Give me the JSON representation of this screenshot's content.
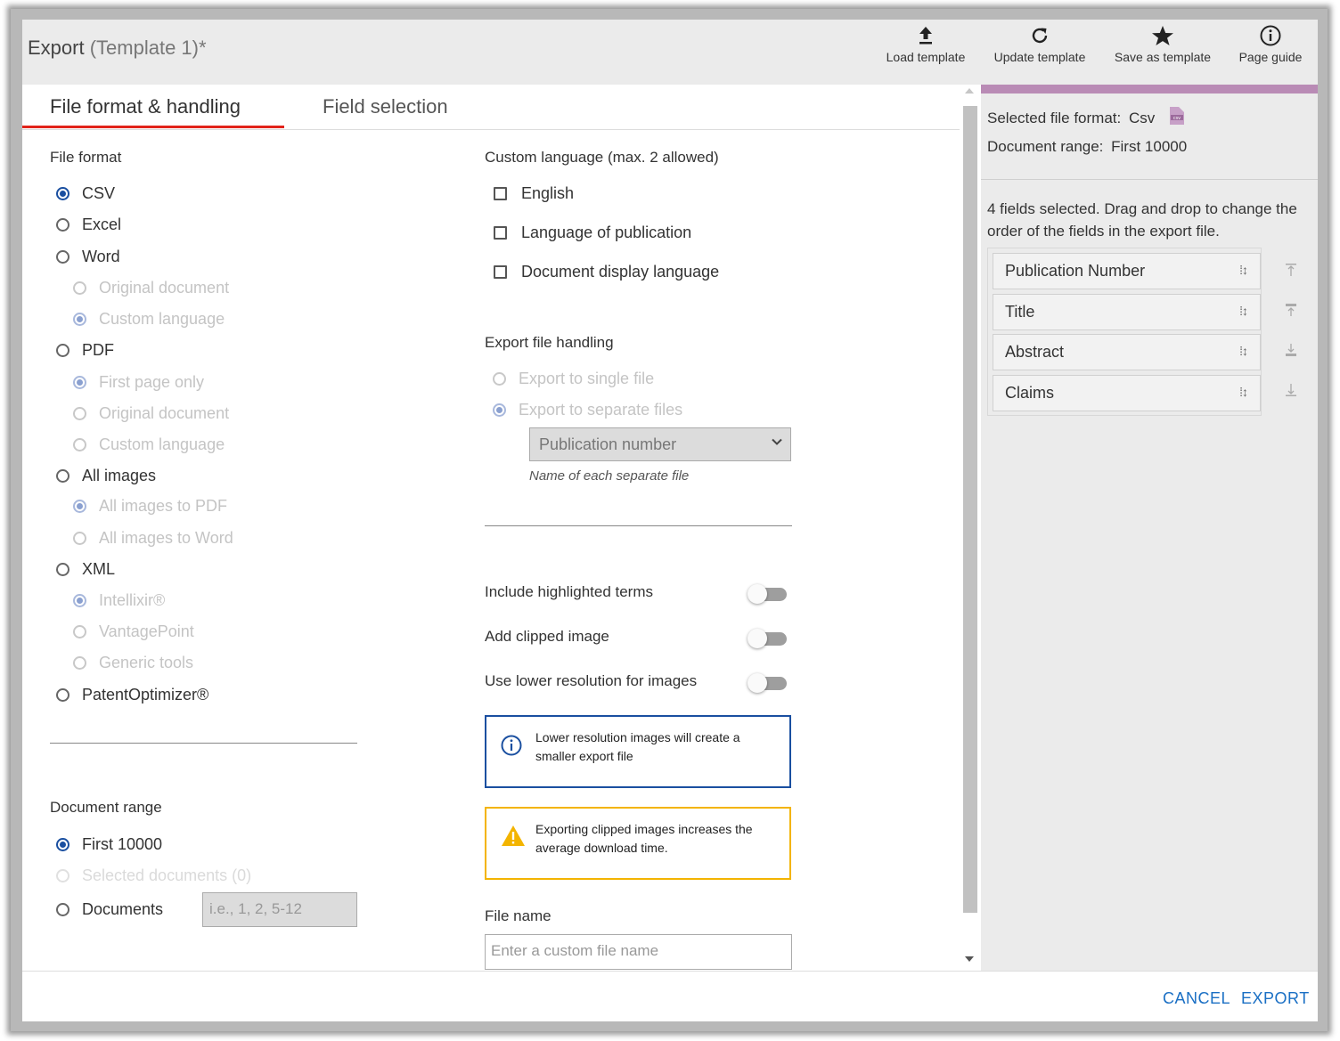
{
  "header": {
    "title_main": "Export",
    "title_sub": "(Template 1)*",
    "tools": [
      "Load template",
      "Update template",
      "Save as template",
      "Page guide"
    ]
  },
  "tabs": [
    "File format & handling",
    "Field selection"
  ],
  "file_format": {
    "label": "File format",
    "options": [
      "CSV",
      "Excel",
      "Word",
      "Original document",
      "Custom language",
      "PDF",
      "First page only",
      "Original document",
      "Custom language",
      "All images",
      "All images to PDF",
      "All images to Word",
      "XML",
      "Intellixir®",
      "VantagePoint",
      "Generic tools",
      "PatentOptimizer®"
    ],
    "selected": "CSV"
  },
  "document_range": {
    "label": "Document range",
    "options": [
      "First 10000",
      "Selected documents (0)",
      "Documents"
    ],
    "documents_placeholder": "i.e., 1, 2, 5-12"
  },
  "custom_language": {
    "label": "Custom language (max. 2 allowed)",
    "options": [
      "English",
      "Language of publication",
      "Document display language"
    ]
  },
  "export_file_handling": {
    "label": "Export file handling",
    "options": [
      "Export to single file",
      "Export to separate files"
    ],
    "name_select": "Publication number",
    "name_hint": "Name of each separate file"
  },
  "toggles": [
    "Include highlighted terms",
    "Add clipped image",
    "Use lower resolution for images"
  ],
  "alerts": {
    "info": "Lower resolution images will create a smaller export file",
    "warning": "Exporting clipped images increases the average download time."
  },
  "file_name": {
    "label": "File name",
    "placeholder": "Enter a custom file name"
  },
  "summary": {
    "format_label": "Selected file format:",
    "format_value": "Csv",
    "range_label": "Document range:",
    "range_value": "First 10000",
    "fields_info": "4 fields selected. Drag and drop to change the order of the fields in the export file.",
    "fields": [
      "Publication Number",
      "Title",
      "Abstract",
      "Claims"
    ]
  },
  "footer": {
    "cancel": "CANCEL",
    "export": "EXPORT"
  },
  "colors": {
    "accent": "#1a4fa0",
    "tab_underline": "#e2231a",
    "panel_bar": "#b98bb5",
    "link": "#1a6fc4",
    "warning": "#f3b400"
  }
}
